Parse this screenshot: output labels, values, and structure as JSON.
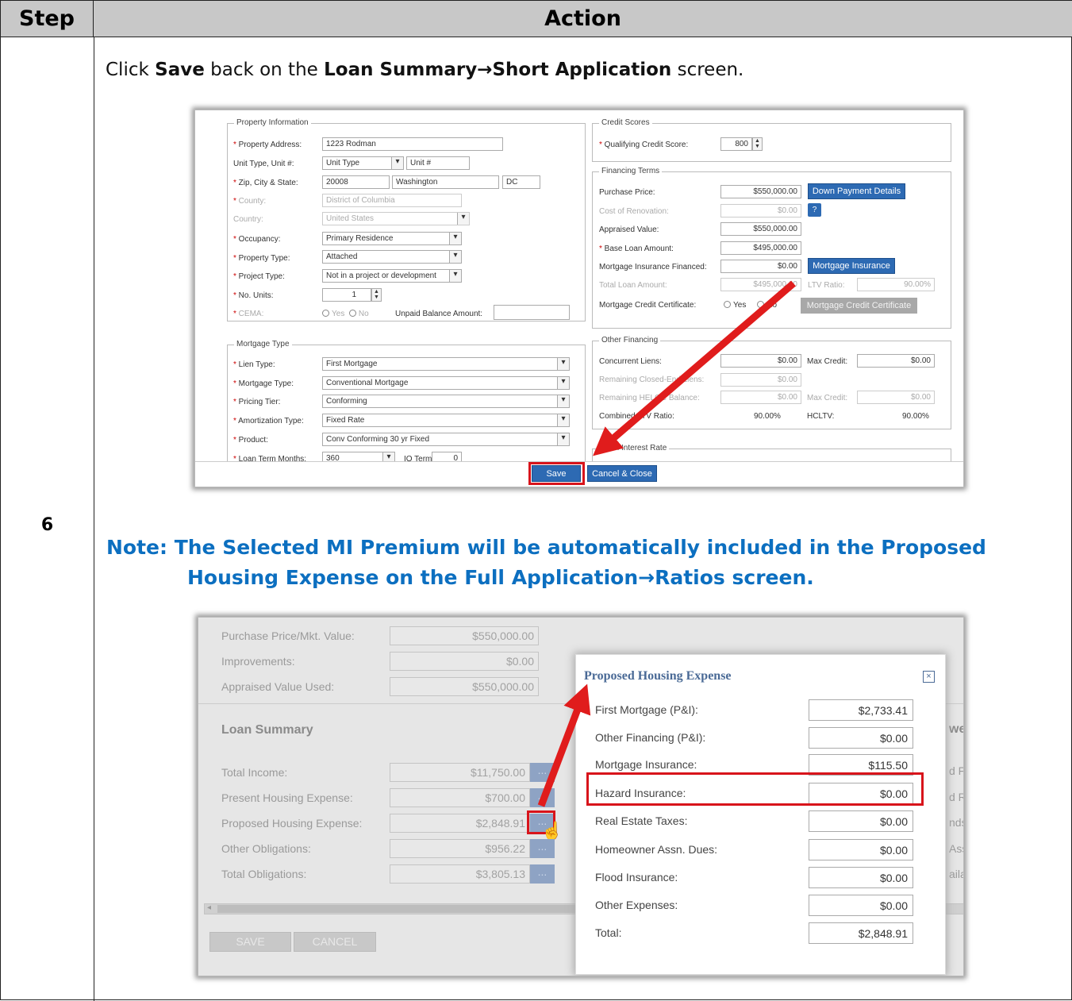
{
  "table": {
    "step_header": "Step",
    "action_header": "Action",
    "step_number": "6"
  },
  "instruction": {
    "prefix": "Click ",
    "save_word": "Save",
    "middle": " back on the ",
    "screen_path": "Loan Summary→Short Application",
    "suffix": " screen."
  },
  "note": {
    "line1": "Note:  The Selected MI Premium will be automatically included in the Proposed",
    "line2": "Housing Expense on the Full Application→Ratios screen."
  },
  "short_app": {
    "property": {
      "legend": "Property Information",
      "address_label": "Property Address:",
      "address_value": "1223 Rodman",
      "unit_label": "Unit Type, Unit #:",
      "unit_type_value": "Unit Type",
      "unit_num_value": "Unit #",
      "zip_label": "Zip, City & State:",
      "zip_value": "20008",
      "city_value": "Washington",
      "state_value": "DC",
      "county_label": "County:",
      "county_value": "District of Columbia",
      "country_label": "Country:",
      "country_value": "United States",
      "occupancy_label": "Occupancy:",
      "occupancy_value": "Primary Residence",
      "ptype_label": "Property Type:",
      "ptype_value": "Attached",
      "project_label": "Project Type:",
      "project_value": "Not in a project or development",
      "units_label": "No. Units:",
      "units_value": "1",
      "cema_label": "CEMA:",
      "yes": "Yes",
      "no": "No",
      "unpaid_label": "Unpaid Balance Amount:"
    },
    "mortgage": {
      "legend": "Mortgage Type",
      "lien_label": "Lien Type:",
      "lien_value": "First Mortgage",
      "mtype_label": "Mortgage Type:",
      "mtype_value": "Conventional Mortgage",
      "tier_label": "Pricing Tier:",
      "tier_value": "Conforming",
      "amort_label": "Amortization Type:",
      "amort_value": "Fixed Rate",
      "product_label": "Product:",
      "product_value": "Conv Conforming 30 yr Fixed",
      "term_label": "Loan Term Months:",
      "term_value": "360",
      "io_label": "IO Term:",
      "io_value": "0"
    },
    "credit": {
      "legend": "Credit Scores",
      "score_label": "Qualifying Credit Score:",
      "score_value": "800"
    },
    "financing": {
      "legend": "Financing Terms",
      "purchase_label": "Purchase Price:",
      "purchase_value": "$550,000.00",
      "down_payment_button": "Down Payment Details",
      "renovation_label": "Cost of Renovation:",
      "renovation_value": "$0.00",
      "help_icon": "?",
      "appraised_label": "Appraised Value:",
      "appraised_value": "$550,000.00",
      "base_label": "Base Loan Amount:",
      "base_value": "$495,000.00",
      "mi_fin_label": "Mortgage Insurance Financed:",
      "mi_fin_value": "$0.00",
      "mi_button": "Mortgage Insurance",
      "total_label": "Total Loan Amount:",
      "total_value": "$495,000.00",
      "ltv_label": "LTV Ratio:",
      "ltv_value": "90.00%",
      "mcc_label": "Mortgage Credit Certificate:",
      "yes": "Yes",
      "no": "No",
      "mcc_button": "Mortgage Credit Certificate"
    },
    "other": {
      "legend": "Other Financing",
      "concurrent_label": "Concurrent Liens:",
      "concurrent_value": "$0.00",
      "max_credit_label": "Max Credit:",
      "max_credit_value": "$0.00",
      "closed_label": "Remaining Closed-End Liens:",
      "closed_value": "$0.00",
      "heloc_label": "Remaining HELOC Balance:",
      "heloc_value": "$0.00",
      "max_credit2_label": "Max Credit:",
      "max_credit2_value": "$0.00",
      "cltv_label": "Combined LTV Ratio:",
      "cltv_value": "90.00%",
      "hcltv_label": "HCLTV:",
      "hcltv_value": "90.00%"
    },
    "rate": {
      "legend": "Loan Interest Rate"
    },
    "footer": {
      "save_button": "Save",
      "cancel_button": "Cancel & Close"
    }
  },
  "ratios": {
    "purchase_label": "Purchase Price/Mkt. Value:",
    "purchase_value": "$550,000.00",
    "improvements_label": "Improvements:",
    "improvements_value": "$0.00",
    "appraised_label": "Appraised Value Used:",
    "appraised_value": "$550,000.00",
    "section_title": "Loan Summary",
    "income_label": "Total Income:",
    "income_value": "$11,750.00",
    "present_label": "Present Housing Expense:",
    "present_value": "$700.00",
    "proposed_label": "Proposed Housing Expense:",
    "proposed_value": "$2,848.91",
    "obligations_label": "Other Obligations:",
    "obligations_value": "$956.22",
    "total_obl_label": "Total Obligations:",
    "total_obl_value": "$3,805.13",
    "dots": "...",
    "save_button": "SAVE",
    "cancel_button": "CANCEL",
    "right_fragments": [
      "wer",
      "d Fu",
      "d Re",
      "nds",
      "Ass",
      "ailal"
    ],
    "scroll_left": "◂"
  },
  "dialog": {
    "title": "Proposed Housing Expense",
    "close": "×",
    "rows": [
      {
        "label": "First Mortgage (P&I):",
        "value": "$2,733.41"
      },
      {
        "label": "Other Financing (P&I):",
        "value": "$0.00"
      },
      {
        "label": "Mortgage Insurance:",
        "value": "$115.50"
      },
      {
        "label": "Hazard Insurance:",
        "value": "$0.00"
      },
      {
        "label": "Real Estate Taxes:",
        "value": "$0.00"
      },
      {
        "label": "Homeowner Assn. Dues:",
        "value": "$0.00"
      },
      {
        "label": "Flood Insurance:",
        "value": "$0.00"
      },
      {
        "label": "Other Expenses:",
        "value": "$0.00"
      },
      {
        "label": "Total:",
        "value": "$2,848.91"
      }
    ]
  },
  "colors": {
    "note_blue": "#0c6fc0",
    "highlight_red": "#d8141b",
    "button_blue": "#2d6ab3"
  }
}
